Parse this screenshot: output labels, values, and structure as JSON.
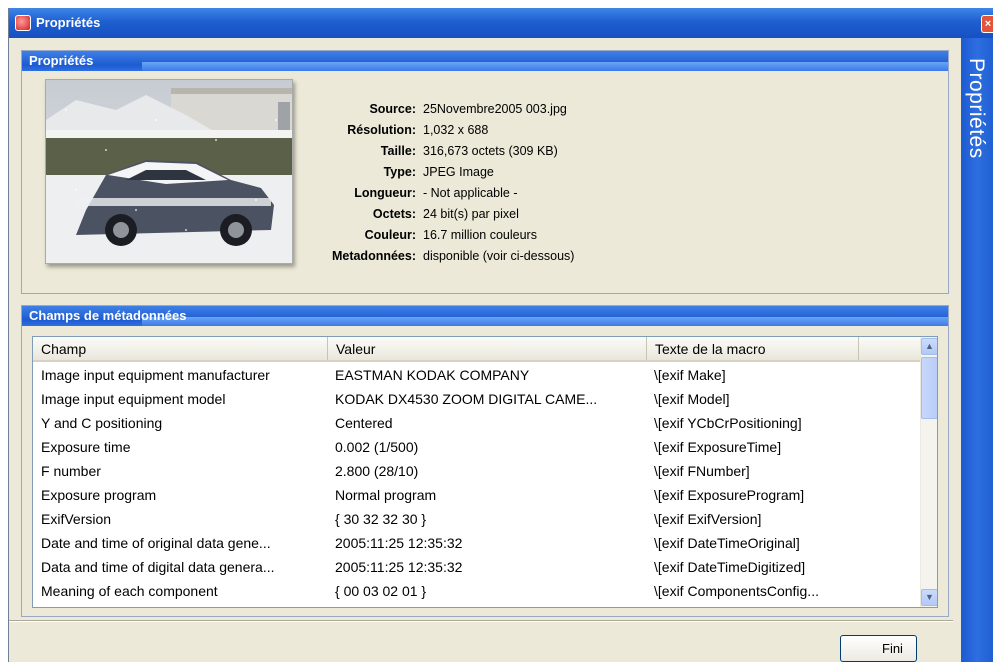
{
  "window": {
    "title": "Propriétés"
  },
  "sidebar": {
    "label": "Propriétés"
  },
  "properties_panel": {
    "heading": "Propriétés",
    "fields": [
      {
        "label": "Source:",
        "value": "25Novembre2005 003.jpg"
      },
      {
        "label": "Résolution:",
        "value": "1,032 x 688"
      },
      {
        "label": "Taille:",
        "value": "316,673 octets (309 KB)"
      },
      {
        "label": "Type:",
        "value": "JPEG Image"
      },
      {
        "label": "Longueur:",
        "value": "- Not applicable -"
      },
      {
        "label": "Octets:",
        "value": "24 bit(s) par pixel"
      },
      {
        "label": "Couleur:",
        "value": "16.7 million couleurs"
      },
      {
        "label": "Metadonnées:",
        "value": "disponible (voir ci-dessous)"
      }
    ]
  },
  "metadata_panel": {
    "heading": "Champs de métadonnées",
    "columns": [
      "Champ",
      "Valeur",
      "Texte de la macro"
    ],
    "rows": [
      [
        "Image input equipment manufacturer",
        "EASTMAN KODAK COMPANY",
        "\\[exif Make]"
      ],
      [
        "Image input equipment model",
        "KODAK DX4530 ZOOM DIGITAL CAME...",
        "\\[exif Model]"
      ],
      [
        "Y and C positioning",
        "Centered",
        "\\[exif YCbCrPositioning]"
      ],
      [
        "Exposure time",
        "0.002 (1/500)",
        "\\[exif ExposureTime]"
      ],
      [
        "F number",
        "2.800 (28/10)",
        "\\[exif FNumber]"
      ],
      [
        "Exposure program",
        "Normal program",
        "\\[exif ExposureProgram]"
      ],
      [
        "ExifVersion",
        "{ 30 32 32 30 }",
        "\\[exif ExifVersion]"
      ],
      [
        "Date and time of original data gene...",
        "2005:11:25 12:35:32",
        "\\[exif DateTimeOriginal]"
      ],
      [
        "Data and time of digital data genera...",
        "2005:11:25 12:35:32",
        "\\[exif DateTimeDigitized]"
      ],
      [
        "Meaning of each component",
        "{ 00 03 02 01 }",
        "\\[exif ComponentsConfig..."
      ]
    ]
  },
  "footer": {
    "finish_label": "Fini"
  }
}
